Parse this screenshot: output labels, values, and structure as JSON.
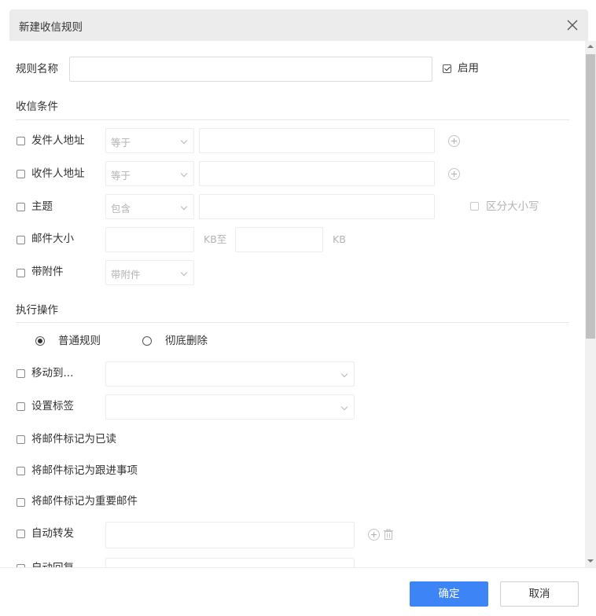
{
  "dialog": {
    "title": "新建收信规则"
  },
  "rule_name": {
    "label": "规则名称",
    "value": "",
    "enable_label": "启用",
    "enabled": true
  },
  "conditions": {
    "section_title": "收信条件",
    "sender": {
      "label": "发件人地址",
      "operator": "等于",
      "value": ""
    },
    "recipient": {
      "label": "收件人地址",
      "operator": "等于",
      "value": ""
    },
    "subject": {
      "label": "主题",
      "operator": "包含",
      "value": "",
      "case_label": "区分大小写"
    },
    "size": {
      "label": "邮件大小",
      "unit_from": "KB至",
      "unit_to": "KB"
    },
    "attachment": {
      "label": "带附件",
      "option": "带附件"
    }
  },
  "actions": {
    "section_title": "执行操作",
    "mode_normal": "普通规则",
    "mode_delete": "彻底删除",
    "mode_selected": "普通规则",
    "move_to": {
      "label": "移动到...",
      "value": ""
    },
    "set_tag": {
      "label": "设置标签",
      "value": ""
    },
    "mark_read": "将邮件标记为已读",
    "mark_followup": "将邮件标记为跟进事项",
    "mark_important": "将邮件标记为重要邮件",
    "auto_forward": {
      "label": "自动转发",
      "value": ""
    },
    "auto_reply": {
      "label": "自动回复"
    }
  },
  "footer": {
    "confirm_label": "确定",
    "cancel_label": "取消"
  },
  "colors": {
    "primary": "#3d84f7",
    "header_bg": "#ececec"
  }
}
